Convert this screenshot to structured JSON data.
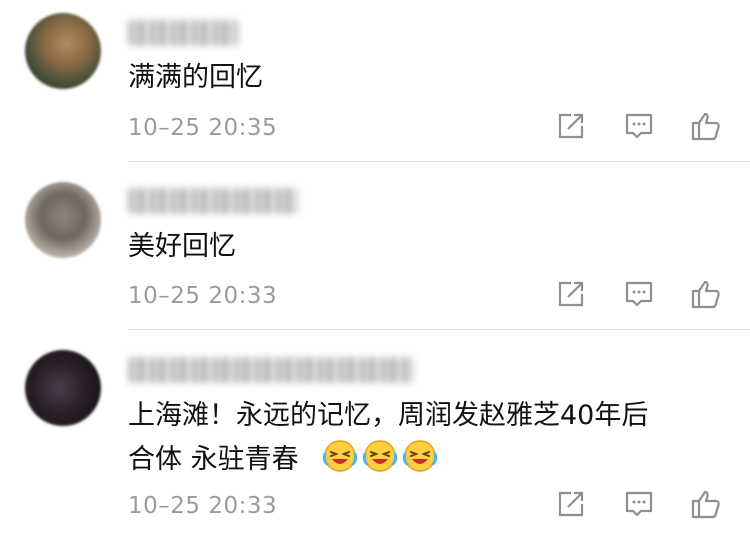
{
  "comments": [
    {
      "text_line1": "满满的回忆",
      "text_line2": "",
      "time": "10–25 20:35"
    },
    {
      "text_line1": "美好回忆",
      "text_line2": "",
      "time": "10–25 20:33"
    },
    {
      "text_line1": "上海滩！永远的记忆，周润发赵雅芝40年后",
      "text_line2": "合体 永驻青春",
      "time": "10–25 20:33",
      "emojis": [
        "laughing-tears-icon",
        "laughing-tears-icon",
        "laughing-tears-icon"
      ]
    }
  ],
  "icons": {
    "share": "share-icon",
    "reply": "reply-icon",
    "like": "thumbs-up-icon"
  },
  "colors": {
    "time_text": "#9b9b9b",
    "icon_stroke": "#8f8f8f",
    "divider": "#e2e2e2"
  }
}
